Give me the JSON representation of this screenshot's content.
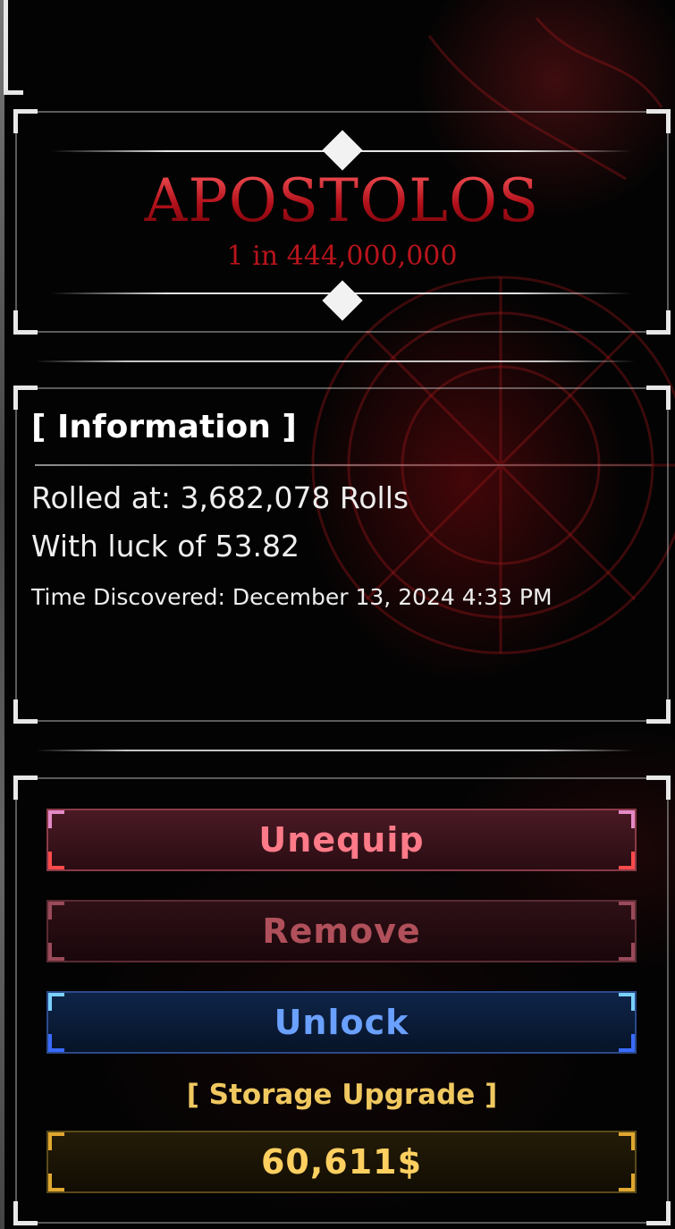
{
  "aura": {
    "name": "APOSTOLOS",
    "rarity": "1 in 444,000,000"
  },
  "information": {
    "title": "[ Information ]",
    "rolled_at": "Rolled at: 3,682,078 Rolls",
    "luck": "With luck of 53.82",
    "time_discovered": "Time Discovered: December 13, 2024 4:33 PM"
  },
  "actions": {
    "unequip_label": "Unequip",
    "remove_label": "Remove",
    "unlock_label": "Unlock",
    "storage_upgrade_label": "[ Storage Upgrade ]",
    "price_label": "60,611$"
  },
  "colors": {
    "aura_red": "#b8141c",
    "unequip_text": "#ff7a88",
    "remove_text": "#b0505a",
    "unlock_text": "#6aa0ff",
    "gold_text": "#ffd060"
  }
}
